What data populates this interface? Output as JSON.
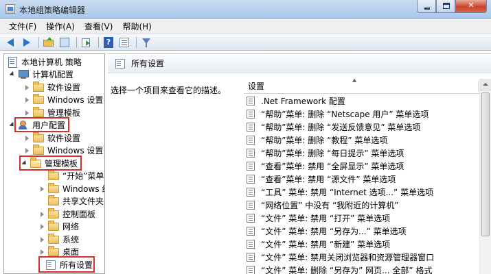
{
  "window": {
    "title": "本地组策略编辑器",
    "minimize_glyph": "",
    "maximize_glyph": "",
    "close_glyph": "✕"
  },
  "menu": [
    "文件(F)",
    "操作(A)",
    "查看(V)",
    "帮助(H)"
  ],
  "toolbar": {
    "icons": [
      "back-arrow-icon",
      "forward-arrow-icon",
      "up-folder-icon",
      "show-tree-icon",
      "export-list-icon",
      "help-icon",
      "properties-icon",
      "filter-icon"
    ]
  },
  "tree": {
    "root": "本地计算机 策略",
    "computer_config": "计算机配置",
    "cc_software": "软件设置",
    "cc_windows": "Windows 设置",
    "cc_templates": "管理模板",
    "user_config": "用户配置",
    "uc_software": "软件设置",
    "uc_windows": "Windows 设置",
    "uc_templates": "管理模板",
    "t_start": "“开始”菜单",
    "t_windows": "Windows 组件",
    "t_shared": "共享文件夹",
    "t_control": "控制面板",
    "t_network": "网络",
    "t_system": "系统",
    "t_desktop": "桌面",
    "t_all": "所有设置"
  },
  "pane": {
    "header": "所有设置",
    "description": "选择一个项目来查看它的描述。",
    "column": "设置",
    "sort_glyph": "▲"
  },
  "settings": [
    ".Net Framework 配置",
    "“帮助”菜单: 删除 “Netscape 用户” 菜单选项",
    "“帮助”菜单: 删除 “发送反馈意见” 菜单选项",
    "“帮助”菜单: 删除 “教程” 菜单选项",
    "“帮助”菜单: 删除 “每日提示” 菜单选项",
    "“查看”菜单: 禁用 “全屏显示” 菜单选项",
    "“查看”菜单: 禁用 “源文件” 菜单选项",
    "“工具” 菜单: 禁用 “Internet 选项...” 菜单选项",
    "“网络位置” 中没有 “我附近的计算机”",
    "“文件” 菜单: 禁用 “打开” 菜单选项",
    "“文件” 菜单: 禁用 “另存为...” 菜单选项",
    "“文件” 菜单: 禁用 “新建” 菜单选项",
    "“文件” 菜单: 禁用关闭浏览器和资源管理器窗口",
    "“文件” 菜单: 删除 “另存为” 网页... 全部” 格式"
  ],
  "colors": {
    "highlight_box": "#d62d2d"
  }
}
